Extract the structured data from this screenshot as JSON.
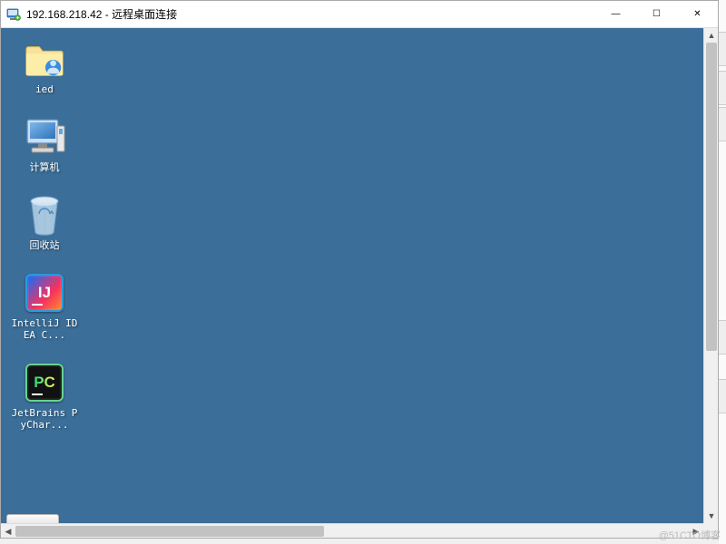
{
  "window": {
    "title": "192.168.218.42 - 远程桌面连接",
    "controls": {
      "minimize": "—",
      "maximize": "☐",
      "close": "✕"
    }
  },
  "desktop": {
    "icons": [
      {
        "id": "ied-folder",
        "label": "ied",
        "type": "folder"
      },
      {
        "id": "computer",
        "label": "计算机",
        "type": "computer"
      },
      {
        "id": "recycle-bin",
        "label": "回收站",
        "type": "recycle-bin"
      },
      {
        "id": "intellij",
        "label": "IntelliJ IDEA C...",
        "type": "ij"
      },
      {
        "id": "pycharm",
        "label": "JetBrains PyChar...",
        "type": "pc"
      }
    ]
  },
  "watermark": "@51CTO博客"
}
